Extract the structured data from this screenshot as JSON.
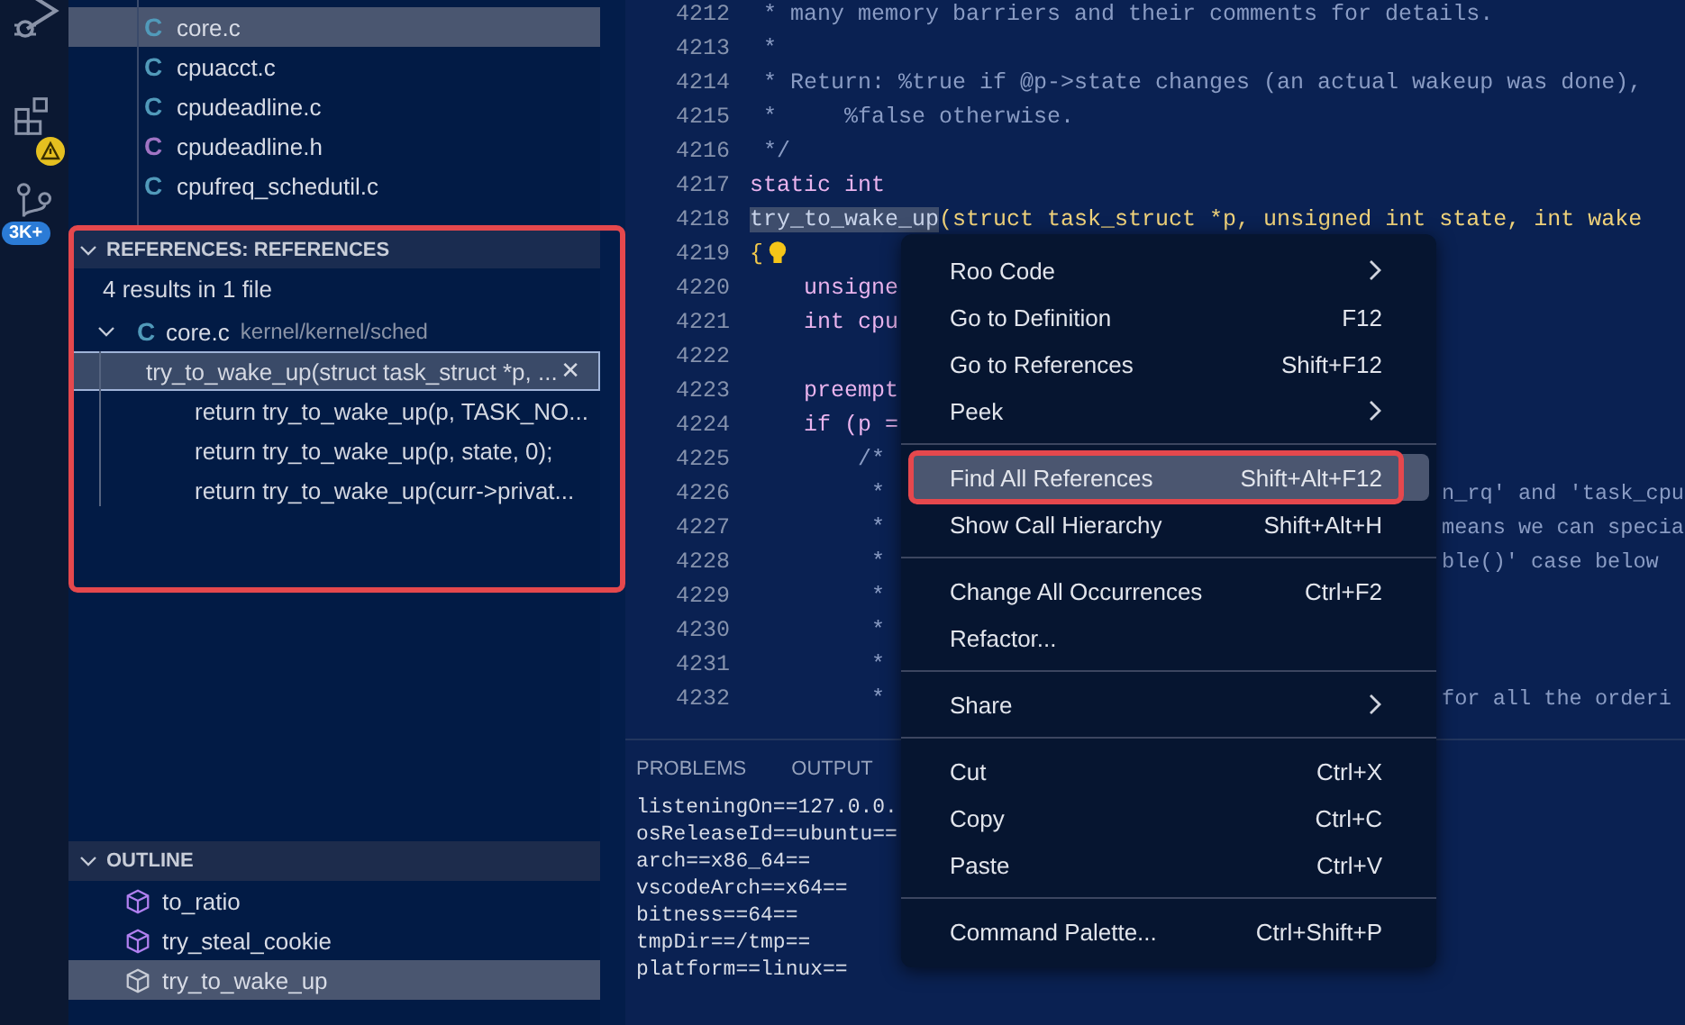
{
  "activity_bar": {
    "extensions_warning": true,
    "source_control_badge": "3K+"
  },
  "explorer": {
    "files": [
      {
        "name": "core.c",
        "letter": "C",
        "color": "#519aba",
        "selected": true
      },
      {
        "name": "cpuacct.c",
        "letter": "C",
        "color": "#519aba",
        "selected": false
      },
      {
        "name": "cpudeadline.c",
        "letter": "C",
        "color": "#519aba",
        "selected": false
      },
      {
        "name": "cpudeadline.h",
        "letter": "C",
        "color": "#a074c4",
        "selected": false
      },
      {
        "name": "cpufreq_schedutil.c",
        "letter": "C",
        "color": "#519aba",
        "selected": false
      }
    ]
  },
  "references": {
    "title": "REFERENCES: REFERENCES",
    "expanded": true,
    "annotated": true,
    "summary": "4 results in 1 file",
    "file": {
      "letter": "C",
      "name": "core.c",
      "path": "kernel/kernel/sched",
      "expanded": true
    },
    "results": [
      {
        "text": "try_to_wake_up(struct task_struct *p, ...",
        "selected": true,
        "close": "✕"
      },
      {
        "text": "return try_to_wake_up(p, TASK_NO...",
        "selected": false
      },
      {
        "text": "return try_to_wake_up(p, state, 0);",
        "selected": false
      },
      {
        "text": "return try_to_wake_up(curr->privat...",
        "selected": false
      }
    ]
  },
  "outline": {
    "title": "OUTLINE",
    "expanded": true,
    "items": [
      {
        "name": "to_ratio",
        "selected": false
      },
      {
        "name": "try_steal_cookie",
        "selected": false
      },
      {
        "name": "try_to_wake_up",
        "selected": true
      }
    ]
  },
  "editor": {
    "lines": [
      {
        "number": "4212",
        "kind": "comment",
        "text": " * many memory barriers and their comments for details."
      },
      {
        "number": "4213",
        "kind": "comment",
        "text": " *"
      },
      {
        "number": "4214",
        "kind": "comment",
        "text": " * Return: %true if @p->state changes (an actual wakeup was done),"
      },
      {
        "number": "4215",
        "kind": "comment",
        "text": " *     %false otherwise."
      },
      {
        "number": "4216",
        "kind": "comment",
        "text": " */"
      },
      {
        "number": "4217",
        "kind": "code",
        "text": "static int"
      },
      {
        "number": "4218",
        "kind": "signature",
        "name": "try_to_wake_up",
        "text": "(struct task_struct *p, unsigned int state, int wake"
      },
      {
        "number": "4219",
        "kind": "brace",
        "text": "{",
        "lightbulb": true
      },
      {
        "number": "4220",
        "kind": "code",
        "text": "    unsigne"
      },
      {
        "number": "4221",
        "kind": "code",
        "text": "    int cpu"
      },
      {
        "number": "4222",
        "kind": "code"
      },
      {
        "number": "4223",
        "kind": "code",
        "text": "    preempt"
      },
      {
        "number": "4224",
        "kind": "code",
        "text": "    if (p ="
      },
      {
        "number": "4225",
        "kind": "comment",
        "text": "        /*"
      },
      {
        "number": "4226",
        "kind": "comment",
        "text": "         *",
        "tail": "n_rq' and 'task_cpu"
      },
      {
        "number": "4227",
        "kind": "comment",
        "text": "         *",
        "tail": "means we can specia"
      },
      {
        "number": "4228",
        "kind": "comment",
        "text": "         *",
        "tail": "ble()' case below"
      },
      {
        "number": "4229",
        "kind": "comment",
        "text": "         *"
      },
      {
        "number": "4230",
        "kind": "comment",
        "text": "         *"
      },
      {
        "number": "4231",
        "kind": "comment",
        "text": "         *"
      },
      {
        "number": "4232",
        "kind": "comment",
        "text": "         *",
        "tail": "for all the orderi"
      }
    ]
  },
  "panel": {
    "tabs": [
      {
        "label": "PROBLEMS",
        "selected": false
      },
      {
        "label": "OUTPUT",
        "selected": false
      }
    ],
    "output": [
      "listeningOn==127.0.0.",
      "osReleaseId==ubuntu==",
      "arch==x86_64==",
      "vscodeArch==x64==",
      "bitness==64==",
      "tmpDir==/tmp==",
      "platform==linux=="
    ]
  },
  "context_menu": {
    "groups": [
      [
        {
          "label": "Roo Code",
          "submenu": true,
          "selected": false
        },
        {
          "label": "Go to Definition",
          "shortcut": "F12",
          "selected": false
        },
        {
          "label": "Go to References",
          "shortcut": "Shift+F12",
          "selected": false
        },
        {
          "label": "Peek",
          "submenu": true,
          "selected": false
        }
      ],
      [
        {
          "label": "Find All References",
          "shortcut": "Shift+Alt+F12",
          "selected": true,
          "annotated": true
        },
        {
          "label": "Show Call Hierarchy",
          "shortcut": "Shift+Alt+H",
          "selected": false
        }
      ],
      [
        {
          "label": "Change All Occurrences",
          "shortcut": "Ctrl+F2",
          "selected": false
        },
        {
          "label": "Refactor...",
          "selected": false
        }
      ],
      [
        {
          "label": "Share",
          "submenu": true,
          "selected": false
        }
      ],
      [
        {
          "label": "Cut",
          "shortcut": "Ctrl+X",
          "selected": false
        },
        {
          "label": "Copy",
          "shortcut": "Ctrl+C",
          "selected": false
        },
        {
          "label": "Paste",
          "shortcut": "Ctrl+V",
          "selected": false
        }
      ],
      [
        {
          "label": "Command Palette...",
          "shortcut": "Ctrl+Shift+P",
          "selected": false
        }
      ]
    ]
  }
}
